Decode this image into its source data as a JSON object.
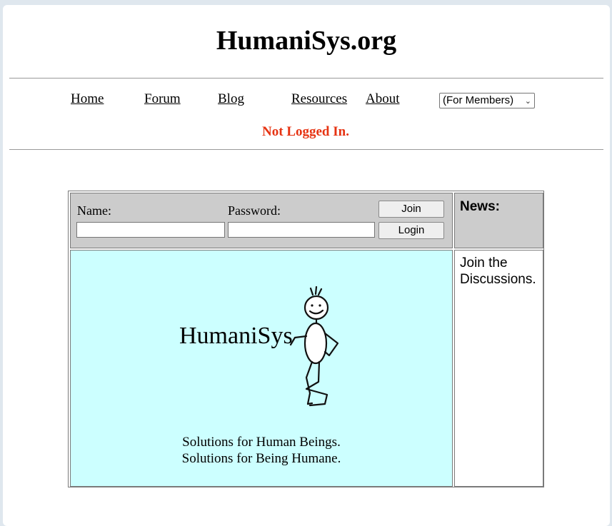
{
  "site": {
    "title": "HumaniSys.org"
  },
  "nav": {
    "items": [
      {
        "label": "Home"
      },
      {
        "label": "Forum"
      },
      {
        "label": "Blog"
      },
      {
        "label": "Resources"
      },
      {
        "label": "About"
      }
    ],
    "members_select": {
      "selected": "(For Members)",
      "icon": "chevron-down-icon"
    }
  },
  "status": {
    "text": "Not Logged In.",
    "color": "#e63312"
  },
  "login": {
    "name_label": "Name:",
    "password_label": "Password:",
    "name_value": "",
    "password_value": "",
    "join_label": "Join",
    "login_label": "Login"
  },
  "news": {
    "heading": "News:"
  },
  "sidebar": {
    "text": "Join the Discussions."
  },
  "hero": {
    "logo_text": "HumaniSys",
    "tagline_1": "Solutions for Human Beings.",
    "tagline_2": "Solutions for Being Humane.",
    "background": "#ccffff"
  }
}
